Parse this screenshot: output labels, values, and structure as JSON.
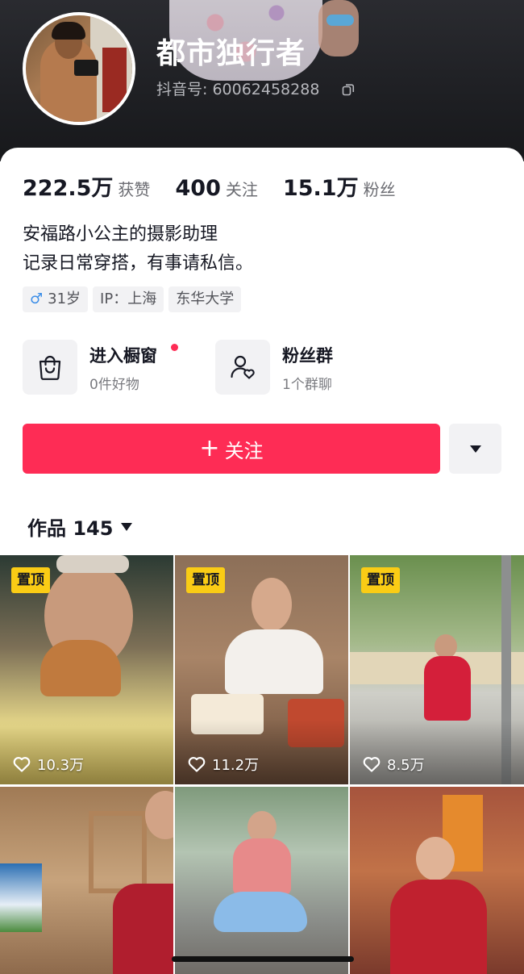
{
  "profile": {
    "username": "都市独行者",
    "douyin_id": "抖音号: 60062458288"
  },
  "stats": [
    {
      "value": "222.5万",
      "label": "获赞"
    },
    {
      "value": "400",
      "label": "关注"
    },
    {
      "value": "15.1万",
      "label": "粉丝"
    }
  ],
  "bio": {
    "line1": "安福路小公主的摄影助理",
    "line2": "记录日常穿搭，有事请私信。"
  },
  "tags": {
    "gender_symbol": "♂",
    "age": "31岁",
    "ip": "IP：上海",
    "school": "东华大学"
  },
  "shop": {
    "title": "进入橱窗",
    "subtitle": "0件好物",
    "icon": "shopping-bag-icon"
  },
  "fan_group": {
    "title": "粉丝群",
    "subtitle": "1个群聊",
    "icon": "user-heart-icon"
  },
  "actions": {
    "follow_plus": "+",
    "follow_label": "关注"
  },
  "works": {
    "label": "作品 145"
  },
  "videos": [
    {
      "pinned_label": "置顶",
      "likes": "10.3万"
    },
    {
      "pinned_label": "置顶",
      "likes": "11.2万"
    },
    {
      "pinned_label": "置顶",
      "likes": "8.5万"
    },
    {
      "pinned_label": "",
      "likes": ""
    },
    {
      "pinned_label": "",
      "likes": ""
    },
    {
      "pinned_label": "",
      "likes": ""
    }
  ],
  "colors": {
    "accent": "#fe2c55",
    "pin_badge": "#facc15",
    "male": "#3c8ee8"
  }
}
